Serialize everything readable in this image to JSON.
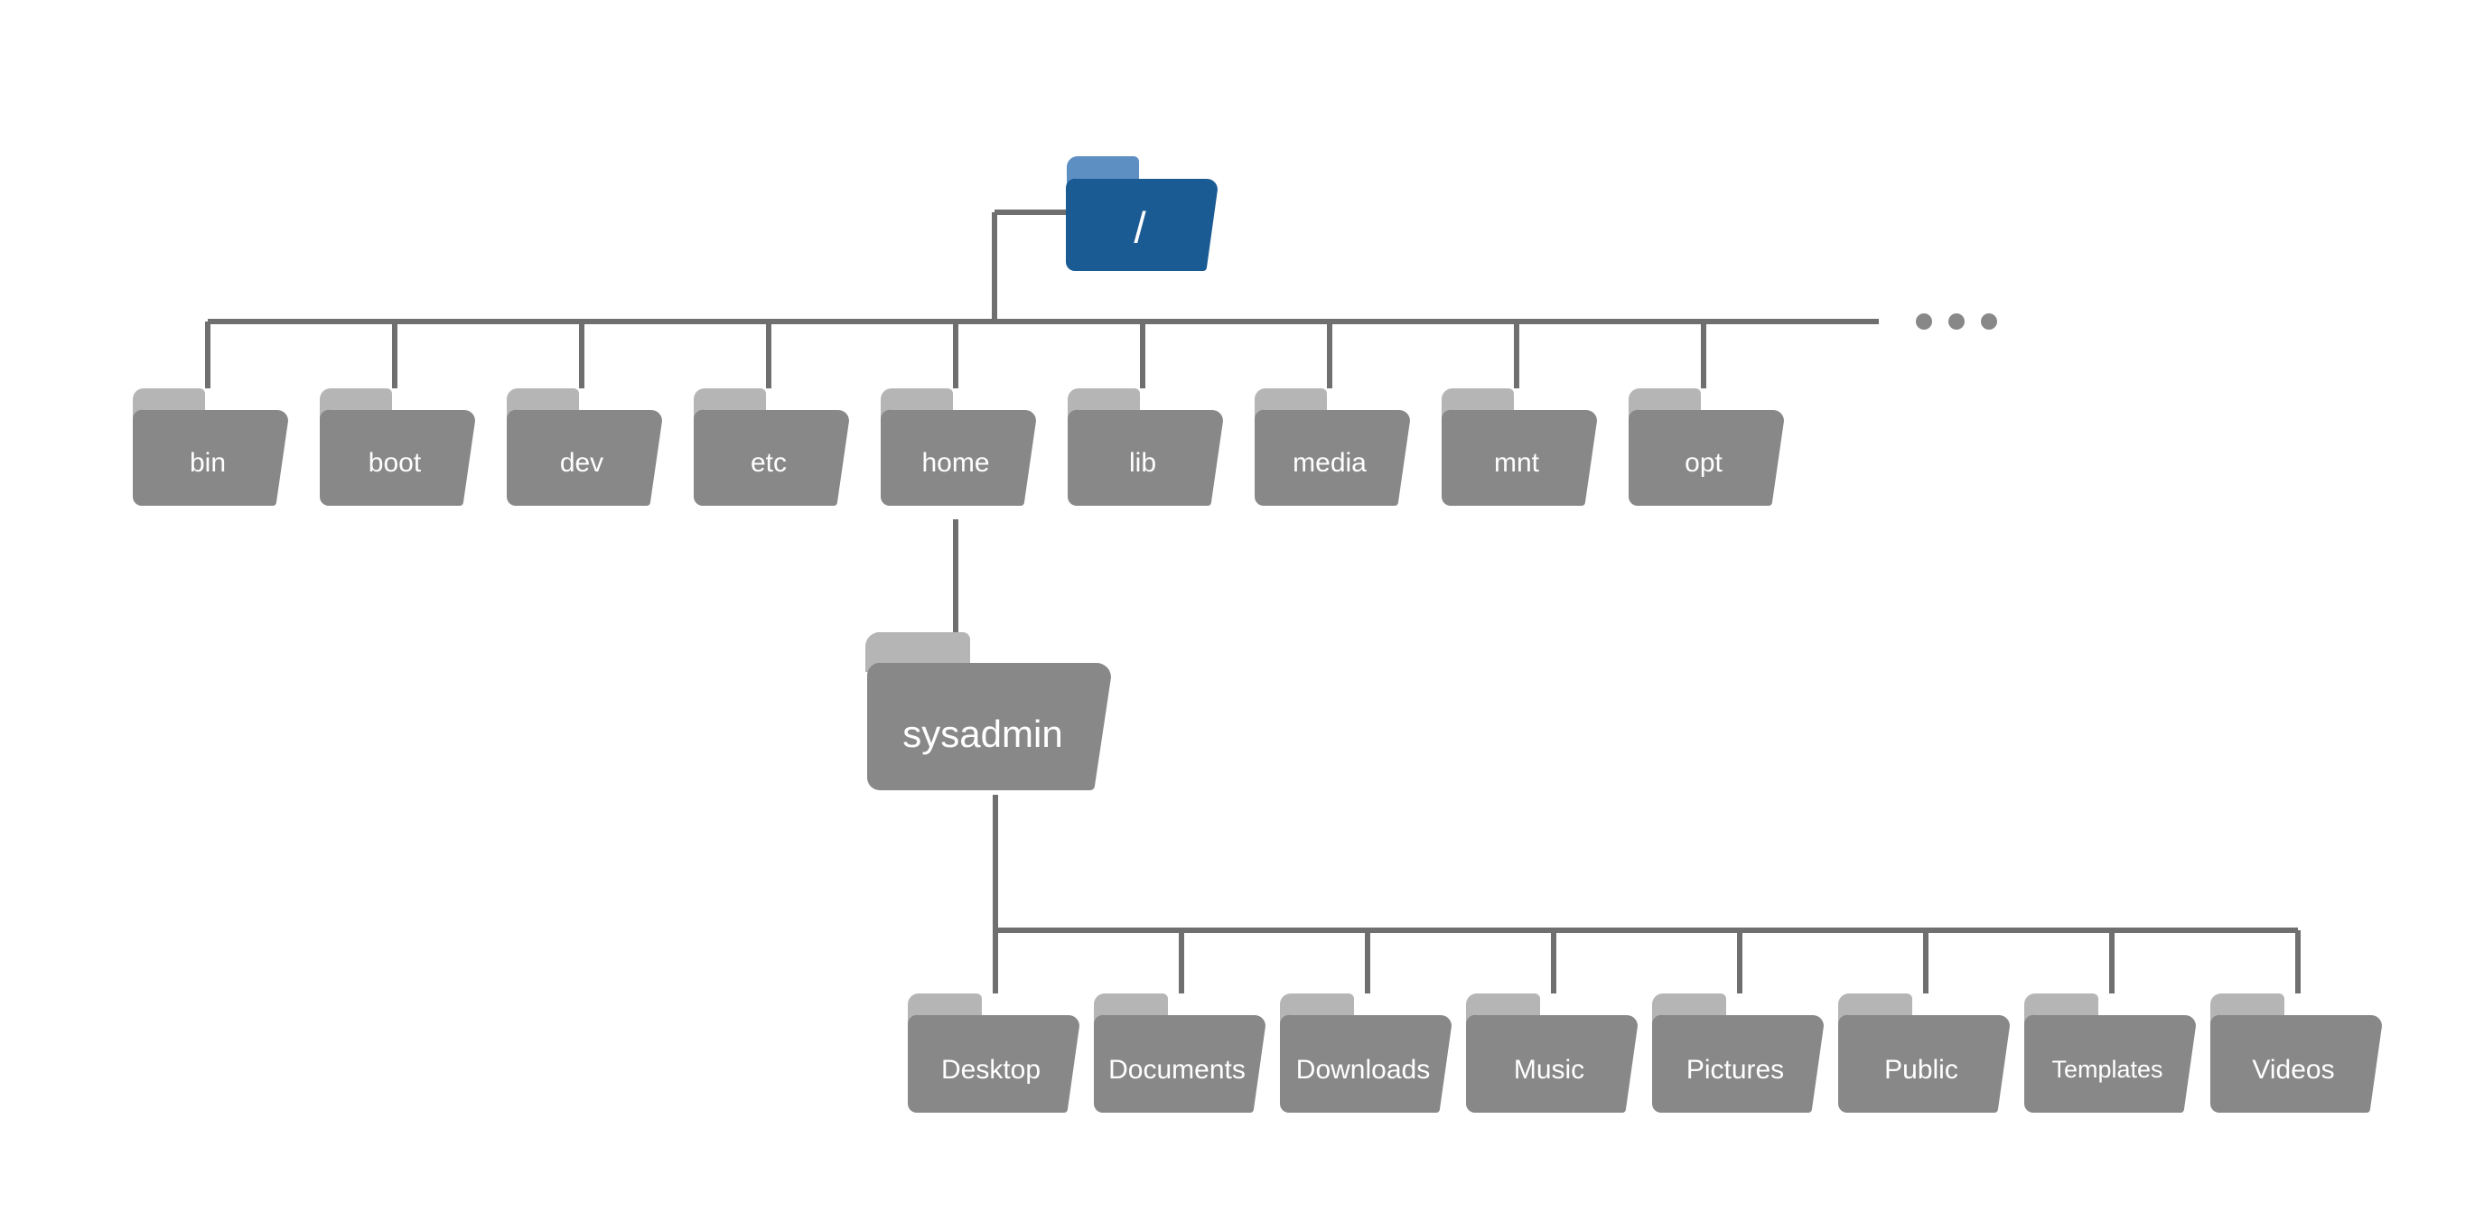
{
  "root": {
    "label": "/"
  },
  "level1": [
    {
      "label": "bin"
    },
    {
      "label": "boot"
    },
    {
      "label": "dev"
    },
    {
      "label": "etc"
    },
    {
      "label": "home"
    },
    {
      "label": "lib"
    },
    {
      "label": "media"
    },
    {
      "label": "mnt"
    },
    {
      "label": "opt"
    }
  ],
  "ellipsis": "...",
  "home_child": {
    "label": "sysadmin"
  },
  "sysadmin_children": [
    {
      "label": "Desktop"
    },
    {
      "label": "Documents"
    },
    {
      "label": "Downloads"
    },
    {
      "label": "Music"
    },
    {
      "label": "Pictures"
    },
    {
      "label": "Public"
    },
    {
      "label": "Templates"
    },
    {
      "label": "Videos"
    }
  ],
  "colors": {
    "line": "#6f6f6f",
    "folder_body": "#888888",
    "folder_tab": "#b5b5b5",
    "root_body": "#1b5b94",
    "root_tab": "#5d8fc3",
    "ellipsis": "#888888"
  }
}
